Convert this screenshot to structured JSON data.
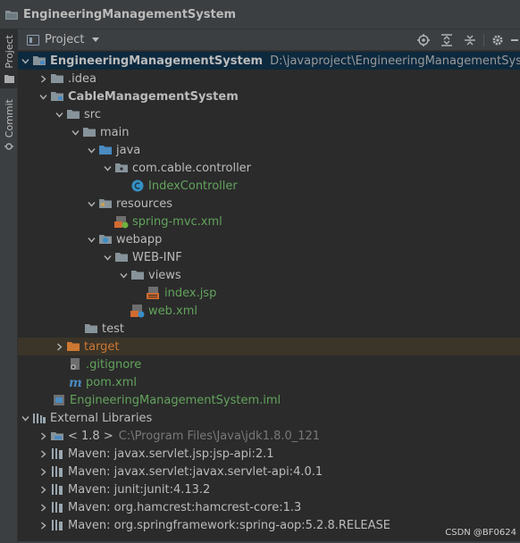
{
  "window": {
    "title": "EngineeringManagementSystem"
  },
  "sidebar": {
    "tabs": [
      {
        "label": "Project",
        "icon": "folder-icon",
        "active": true
      },
      {
        "label": "Commit",
        "icon": "commit-icon",
        "active": false
      }
    ]
  },
  "toolbar": {
    "view_label": "Project",
    "buttons": [
      "locate-icon",
      "expand-all-icon",
      "collapse-all-icon",
      "gear-icon",
      "hide-icon"
    ]
  },
  "tree": {
    "root": {
      "label": "EngineeringManagementSystem",
      "path": "D:\\javaproject\\EngineeringManagementSystem"
    },
    "idea": ".idea",
    "module": "CableManagementSystem",
    "src": "src",
    "main": "main",
    "java": "java",
    "package": "com.cable.controller",
    "controller": "IndexController",
    "resources": "resources",
    "spring_xml": "spring-mvc.xml",
    "webapp": "webapp",
    "webinf": "WEB-INF",
    "views": "views",
    "index_jsp": "index.jsp",
    "web_xml": "web.xml",
    "test": "test",
    "target": "target",
    "gitignore": ".gitignore",
    "pom": "pom.xml",
    "iml": "EngineeringManagementSystem.iml",
    "external_libraries": "External Libraries",
    "jdk": {
      "label": "< 1.8 >",
      "path": "C:\\Program Files\\Java\\jdk1.8.0_121"
    },
    "libraries": [
      "Maven: javax.servlet.jsp:jsp-api:2.1",
      "Maven: javax.servlet:javax.servlet-api:4.0.1",
      "Maven: junit:junit:4.13.2",
      "Maven: org.hamcrest:hamcrest-core:1.3",
      "Maven: org.springframework:spring-aop:5.2.8.RELEASE"
    ]
  },
  "watermark": "CSDN @BF0624",
  "colors": {
    "background": "#2b2b2b",
    "panel": "#3c3f41",
    "selection": "#0d293e",
    "excluded": "#cc7832",
    "green_text": "#62a35c",
    "folder": "#87939a",
    "source_folder": "#4a8bc2"
  }
}
